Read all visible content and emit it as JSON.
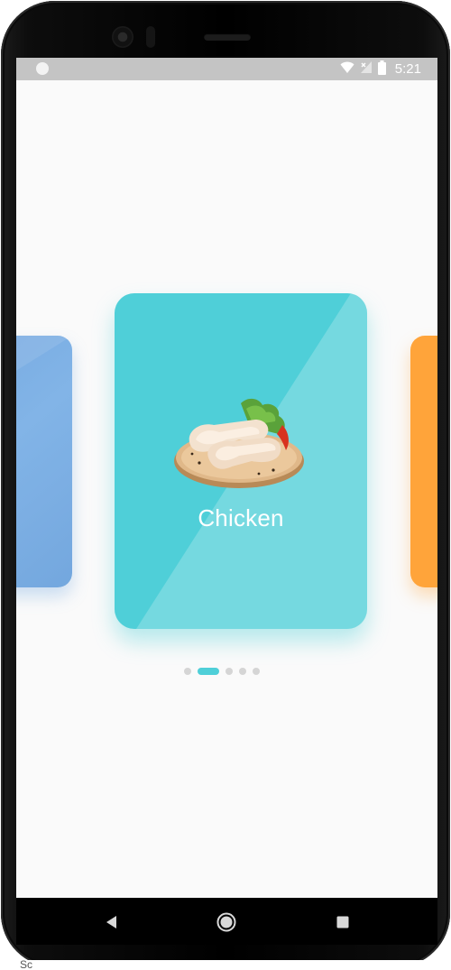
{
  "status_bar": {
    "time": "5:21",
    "icons": [
      "wifi-icon",
      "signal-icon",
      "battery-icon"
    ]
  },
  "carousel": {
    "active_index": 1,
    "cards": [
      {
        "label": "",
        "color": "#6fa5df"
      },
      {
        "label": "Chicken",
        "color": "#4fcfd8",
        "image": "chicken-legs-on-board"
      },
      {
        "label": "",
        "color": "#ffa43a"
      }
    ]
  },
  "pager": {
    "count": 5,
    "active": 1,
    "active_color": "#4fcfd8",
    "inactive_color": "#d5d5d5"
  },
  "nav_bar": {
    "buttons": [
      "back-icon",
      "home-icon",
      "recents-icon"
    ]
  },
  "below_device_text": "Sc"
}
